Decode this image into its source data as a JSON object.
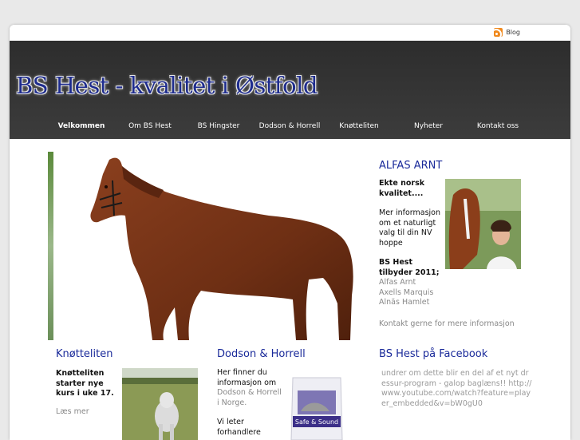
{
  "topbar": {
    "blog_label": "Blog"
  },
  "header": {
    "title": "BS Hest - kvalitet i Østfold"
  },
  "nav": {
    "items": [
      {
        "label": "Velkommen"
      },
      {
        "label": "Om BS Hest"
      },
      {
        "label": "BS Hingster"
      },
      {
        "label": "Dodson & Horrell"
      },
      {
        "label": "Knøtteliten"
      },
      {
        "label": "Nyheter"
      },
      {
        "label": "Kontakt oss"
      }
    ]
  },
  "sidebar": {
    "title": "ALFAS ARNT",
    "intro_bold": "Ekte norsk kvalitet....",
    "info": "Mer informasjon om et naturligt valg til din NV hoppe",
    "offer_title": "BS Hest tilbyder 2011;",
    "horses": [
      "Alfas Arnt",
      "Axells Marquis",
      "Alnäs Hamlet"
    ],
    "contact_link": "Kontakt gerne for mere informasjon"
  },
  "columns": {
    "knotteliten": {
      "title": "Knøtteliten",
      "text": "Knøtteliten starter nye kurs i uke 17.",
      "more": "Læs mer"
    },
    "dodson": {
      "title": "Dodson & Horrell",
      "text1": "Her finner du informasjon om",
      "text1_grey": "Dodson & Horrell",
      "text1_end": "i Norge.",
      "text2": "Vi leter forhandlere",
      "product_label": "Safe & Sound"
    },
    "facebook": {
      "title": "BS Hest på Facebook",
      "post": "undrer om dette blir en del af et nyt dressur-program - galop baglæns!! http://www.youtube.com/watch?feature=player_embedded&v=bW0gU0"
    }
  },
  "icons": {
    "rss": "rss-icon"
  },
  "colors": {
    "heading_blue": "#1a2a9a",
    "header_bg": "#333333",
    "rss_orange": "#f0891d"
  }
}
